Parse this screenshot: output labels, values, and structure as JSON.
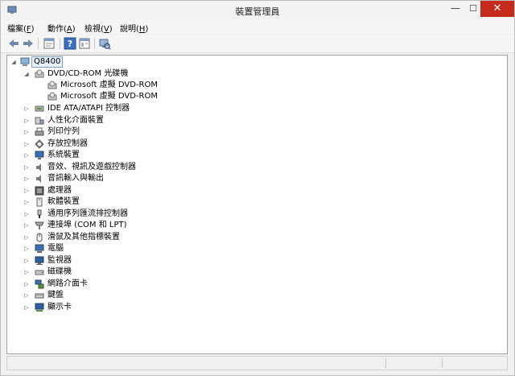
{
  "window": {
    "title": "裝置管理員"
  },
  "menu": [
    {
      "label": "檔案",
      "key": "F"
    },
    {
      "label": "動作",
      "key": "A"
    },
    {
      "label": "檢視",
      "key": "V"
    },
    {
      "label": "說明",
      "key": "H"
    }
  ],
  "toolbar": {
    "buttons": [
      "back-arrow-icon",
      "forward-arrow-icon",
      "properties-icon",
      "help-icon",
      "show-hide-console-tree-icon",
      "scan-hardware-icon"
    ]
  },
  "tree": {
    "root": "Q8400",
    "dvd": {
      "label": "DVD/CD-ROM 光碟機",
      "children": [
        "Microsoft 虛擬 DVD-ROM",
        "Microsoft 虛擬 DVD-ROM"
      ]
    },
    "categories": [
      "IDE ATA/ATAPI 控制器",
      "人性化介面裝置",
      "列印佇列",
      "存放控制器",
      "系統裝置",
      "音效、視訊及遊戲控制器",
      "音訊輸入與輸出",
      "處理器",
      "軟體裝置",
      "通用序列匯流排控制器",
      "連接埠 (COM 和 LPT)",
      "滑鼠及其他指標裝置",
      "電腦",
      "監視器",
      "磁碟機",
      "網路介面卡",
      "鍵盤",
      "顯示卡"
    ]
  }
}
